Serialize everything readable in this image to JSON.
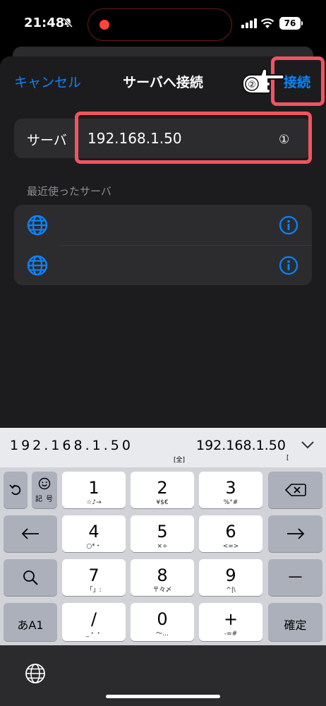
{
  "status": {
    "time": "21:48",
    "battery": "76"
  },
  "nav": {
    "cancel": "キャンセル",
    "title": "サーバへ接続",
    "connect": "接続"
  },
  "annotations": {
    "step1": "①",
    "step2": "②"
  },
  "server": {
    "label": "サーバ",
    "value": "192.168.1.50"
  },
  "recent": {
    "header": "最近使ったサーバ"
  },
  "candidates": {
    "fullwidth": "192.168.1.50",
    "fullwidth_tag": "[全]",
    "halfwidth": "192.168.1.50",
    "halfwidth_tag": "["
  },
  "keys": {
    "k1": {
      "main": "1",
      "sub": "☆♪→"
    },
    "k2": {
      "main": "2",
      "sub": "¥$€"
    },
    "k3": {
      "main": "3",
      "sub": "%°#"
    },
    "k4": {
      "main": "4",
      "sub": "○*・"
    },
    "k5": {
      "main": "5",
      "sub": "×÷"
    },
    "k6": {
      "main": "6",
      "sub": "<=>"
    },
    "k7": {
      "main": "7",
      "sub": "「」:"
    },
    "k8": {
      "main": "8",
      "sub": "〒々〆"
    },
    "k9": {
      "main": "9",
      "sub": "^|\\"
    },
    "k0": {
      "main": "0",
      "sub": "〜…"
    },
    "slash": {
      "main": "/",
      "sub": "_・・"
    },
    "plus": {
      "main": "+",
      "sub": "-=#"
    },
    "kigou_top": "記",
    "kigou_bottom": "号",
    "long_dash": "—",
    "kana_toggle": "あA1",
    "confirm": "確定"
  },
  "icons": {
    "undo": "undo-icon",
    "emoji": "emoji-icon",
    "backspace": "backspace-icon",
    "left": "arrow-left-icon",
    "right": "arrow-right-icon",
    "search": "search-icon",
    "globe": "globe-icon",
    "info": "info-icon"
  },
  "colors": {
    "accent": "#0a84ff",
    "highlight": "#f2545f",
    "sheet": "#1c1c1e",
    "cell": "#2c2c2e"
  }
}
